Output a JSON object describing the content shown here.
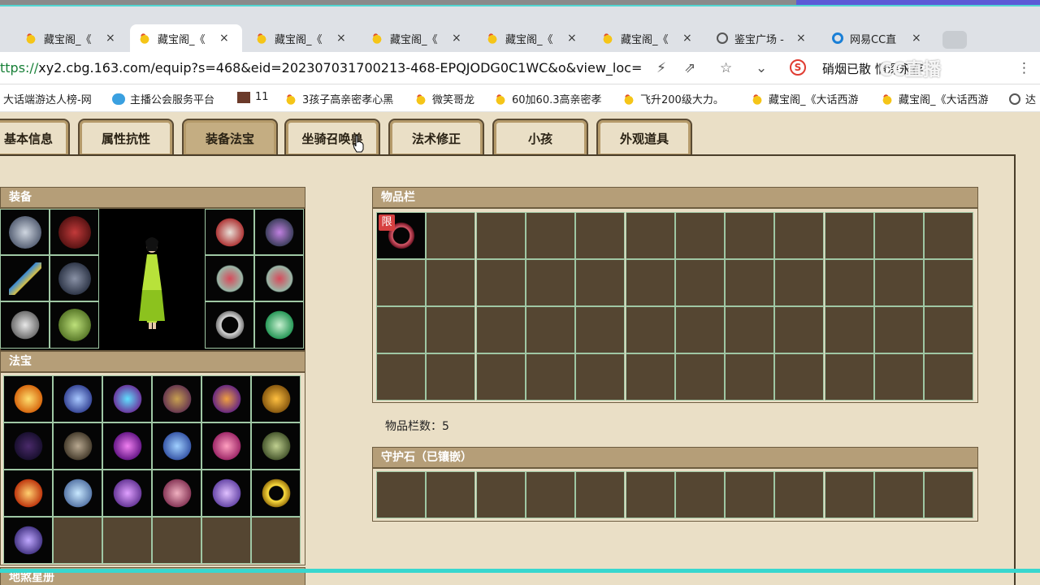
{
  "browser": {
    "tabs": [
      {
        "title": "藏宝阁_《",
        "icon": "chick"
      },
      {
        "title": "藏宝阁_《",
        "icon": "chick"
      },
      {
        "title": "藏宝阁_《",
        "icon": "chick"
      },
      {
        "title": "藏宝阁_《",
        "icon": "chick"
      },
      {
        "title": "藏宝阁_《",
        "icon": "chick"
      },
      {
        "title": "藏宝阁_《",
        "icon": "chick"
      },
      {
        "title": "鉴宝广场 -",
        "icon": "globe"
      },
      {
        "title": "网易CC直",
        "icon": "cc"
      }
    ],
    "url_scheme": "ttps://",
    "url_rest": "xy2.cbg.163.com/equip?s=468&eid=202307031700213-468-EPQJODG0C1WC&o&view_loc=",
    "search_text": "硝烟已散 情深永存",
    "watermark": "CC直播",
    "bookmarks": [
      {
        "label": "大话端游达人榜-网",
        "icon": "none"
      },
      {
        "label": "主播公会服务平台",
        "icon": "cloud"
      },
      {
        "label": "11",
        "icon": "game"
      },
      {
        "label": "3孩子高亲密孝心黑",
        "icon": "chick"
      },
      {
        "label": "微笑哥龙",
        "icon": "chick"
      },
      {
        "label": "60加60.3高亲密孝",
        "icon": "chick"
      },
      {
        "label": "飞升200级大力。",
        "icon": "chick"
      },
      {
        "label": "藏宝阁_《大话西游",
        "icon": "chick"
      },
      {
        "label": "藏宝阁_《大话西游",
        "icon": "chick"
      },
      {
        "label": "达",
        "icon": "globe"
      }
    ]
  },
  "game_tabs": [
    "基本信息",
    "属性抗性",
    "装备法宝",
    "坐骑召唤兽",
    "法术修正",
    "小孩",
    "外观道具"
  ],
  "selected_tab_index": 2,
  "sections": {
    "equipment": "装备",
    "treasure": "法宝",
    "star_book": "地煞星册",
    "inventory": "物品栏",
    "guard_stone": "守护石（已镶嵌）"
  },
  "inventory_count_label": "物品栏数：",
  "inventory_count_value": "5",
  "limit_badge": "限",
  "colors": {
    "slot_bg": "#554632",
    "slot_border": "#9fc7a4",
    "header_bg": "#b59e78",
    "page_bg": "#eadfc6"
  }
}
